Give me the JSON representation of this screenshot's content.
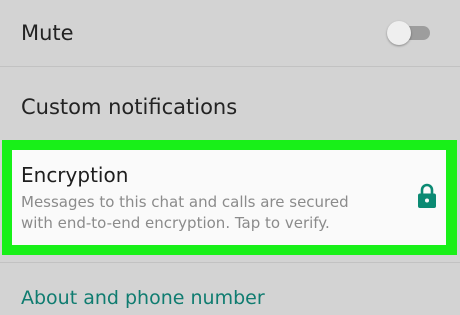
{
  "settings": {
    "mute": {
      "label": "Mute",
      "enabled": false
    },
    "custom_notifications": {
      "label": "Custom notifications"
    },
    "encryption": {
      "title": "Encryption",
      "description": "Messages to this chat and calls are secured with end-to-end encryption. Tap to verify.",
      "icon": "lock-icon"
    },
    "about": {
      "label": "About and phone number"
    }
  },
  "colors": {
    "background": "#d3d3d3",
    "highlight": "#18f018",
    "card": "#fafafa",
    "accent_teal": "#0f7c70",
    "lock_teal": "#0b8a73"
  }
}
